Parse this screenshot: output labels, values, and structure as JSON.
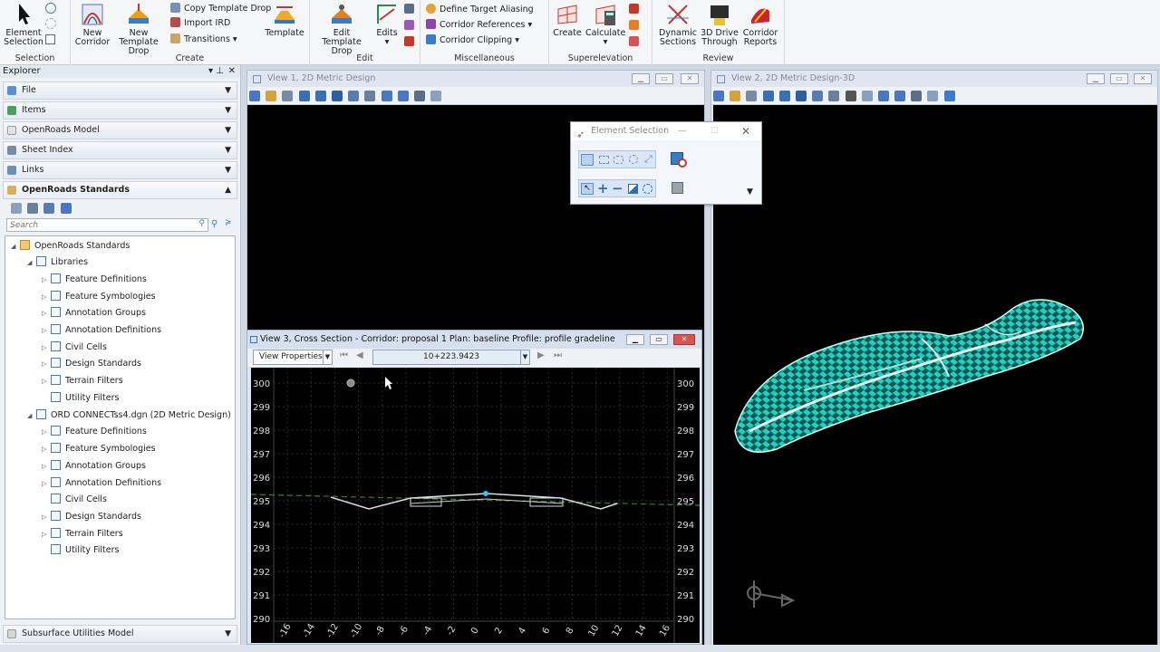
{
  "ribbon": {
    "selection": {
      "label": "Selection",
      "element_selection": "Element\nSelection"
    },
    "create": {
      "label": "Create",
      "new_corridor": "New\nCorridor",
      "new_template_drop": "New\nTemplate Drop",
      "copy_template_drop": "Copy Template Drop",
      "import_ird": "Import IRD",
      "transitions": "Transitions",
      "template": "Template"
    },
    "edit": {
      "label": "Edit",
      "edit_template_drop": "Edit\nTemplate Drop",
      "edits": "Edits"
    },
    "misc": {
      "label": "Miscellaneous",
      "define_target_aliasing": "Define Target Aliasing",
      "corridor_references": "Corridor References",
      "corridor_clipping": "Corridor Clipping"
    },
    "superelevation": {
      "label": "Superelevation",
      "create": "Create",
      "calculate": "Calculate"
    },
    "review": {
      "label": "Review",
      "dynamic_sections": "Dynamic\nSections",
      "drive_through": "3D Drive\nThrough",
      "corridor_reports": "Corridor\nReports"
    }
  },
  "explorer": {
    "title": "Explorer",
    "sections": [
      "File",
      "Items",
      "OpenRoads Model",
      "Sheet Index",
      "Links",
      "OpenRoads Standards"
    ],
    "search_placeholder": "Search",
    "tree": {
      "root": "OpenRoads Standards",
      "libraries": "Libraries",
      "lib_items": [
        "Feature Definitions",
        "Feature Symbologies",
        "Annotation Groups",
        "Annotation Definitions",
        "Civil Cells",
        "Design Standards",
        "Terrain Filters",
        "Utility Filters"
      ],
      "dgn": "ORD CONNECTss4.dgn (2D Metric Design)",
      "dgn_items": [
        "Feature Definitions",
        "Feature Symbologies",
        "Annotation Groups",
        "Annotation Definitions",
        "Civil Cells",
        "Design Standards",
        "Terrain Filters",
        "Utility Filters"
      ]
    },
    "bottom_section": "Subsurface Utilities Model"
  },
  "view1": {
    "title": "View 1, 2D Metric Design"
  },
  "view2": {
    "title": "View 2, 2D Metric Design-3D"
  },
  "view3": {
    "title": "View 3, Cross Section - Corridor: proposal 1 Plan: baseline Profile: profile gradeline",
    "view_properties": "View Properties",
    "station": "10+223.9423",
    "y_labels": [
      "300",
      "299",
      "298",
      "297",
      "296",
      "295",
      "294",
      "293",
      "292",
      "291",
      "290"
    ],
    "x_labels": [
      "-16",
      "-14",
      "-12",
      "-10",
      "-8",
      "-6",
      "-4",
      "-2",
      "0",
      "2",
      "4",
      "6",
      "8",
      "10",
      "12",
      "14",
      "16"
    ]
  },
  "element_selection": {
    "title": "Element Selection"
  },
  "colors": {
    "accent": "#3b7dc4",
    "grid": "#2d2d2d",
    "corridor": "#1fd1c2",
    "canvas": "#000000"
  }
}
